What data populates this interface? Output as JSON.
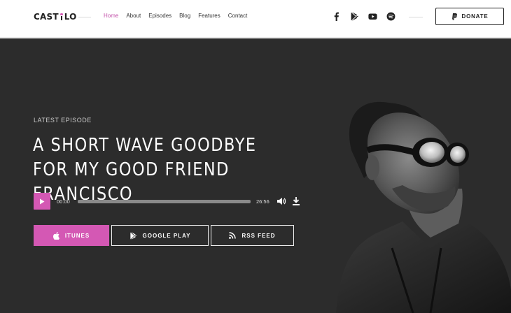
{
  "brand": {
    "name_left": "CAST",
    "name_right": "LO"
  },
  "nav": {
    "items": [
      {
        "label": "Home",
        "active": true
      },
      {
        "label": "About"
      },
      {
        "label": "Episodes"
      },
      {
        "label": "Blog"
      },
      {
        "label": "Features"
      },
      {
        "label": "Contact"
      }
    ]
  },
  "socials": [
    "facebook-icon",
    "google-play-icon",
    "youtube-icon",
    "spotify-icon"
  ],
  "donate": {
    "label": "DONATE",
    "icon": "paypal-icon"
  },
  "hero": {
    "kicker": "LATEST EPISODE",
    "title": "A SHORT WAVE GOODBYE FOR MY GOOD FRIEND FRANCISCO",
    "player": {
      "current_time": "00:00",
      "duration": "26:56",
      "progress": 0
    },
    "buttons": [
      {
        "label": "ITUNES",
        "icon": "apple-icon"
      },
      {
        "label": "GOOGLE PLAY",
        "icon": "google-play-icon"
      },
      {
        "label": "RSS FEED",
        "icon": "rss-icon"
      }
    ]
  },
  "colors": {
    "accent": "#d458b4",
    "hero_bg": "#2c2c2c",
    "header_bg": "#ffffff"
  }
}
